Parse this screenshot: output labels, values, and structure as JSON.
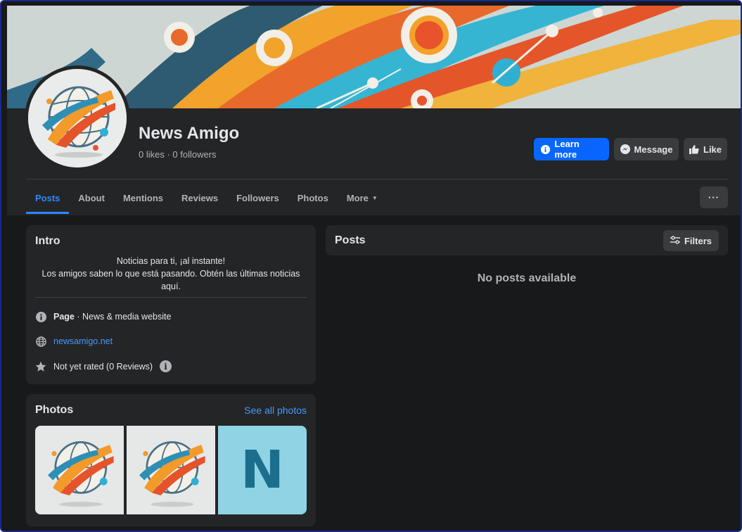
{
  "page": {
    "name": "News Amigo",
    "stats": "0 likes · 0 followers"
  },
  "actions": {
    "learn_more": "Learn more",
    "message": "Message",
    "like": "Like"
  },
  "tabs": [
    {
      "label": "Posts",
      "active": true
    },
    {
      "label": "About"
    },
    {
      "label": "Mentions"
    },
    {
      "label": "Reviews"
    },
    {
      "label": "Followers"
    },
    {
      "label": "Photos"
    },
    {
      "label": "More"
    }
  ],
  "more_menu_label": "···",
  "intro": {
    "title": "Intro",
    "bio_line1": "Noticias para ti, ¡al instante!",
    "bio_line2": "Los amigos saben lo que está pasando. Obtén las últimas noticias aquí.",
    "category_bold": "Page",
    "category_rest": " · News & media website",
    "website": "newsamigo.net",
    "rating": "Not yet rated (0 Reviews)",
    "rating_info": "i"
  },
  "photos": {
    "title": "Photos",
    "see_all": "See all photos",
    "tile3_letter": "N"
  },
  "posts": {
    "title": "Posts",
    "filters": "Filters",
    "empty": "No posts available"
  },
  "colors": {
    "primary": "#0866ff",
    "link": "#4599ff",
    "card": "#242526",
    "background": "#18191a"
  },
  "icons": [
    "info-icon",
    "messenger-icon",
    "thumbs-up-icon",
    "globe-icon",
    "star-icon",
    "filter-icon"
  ]
}
